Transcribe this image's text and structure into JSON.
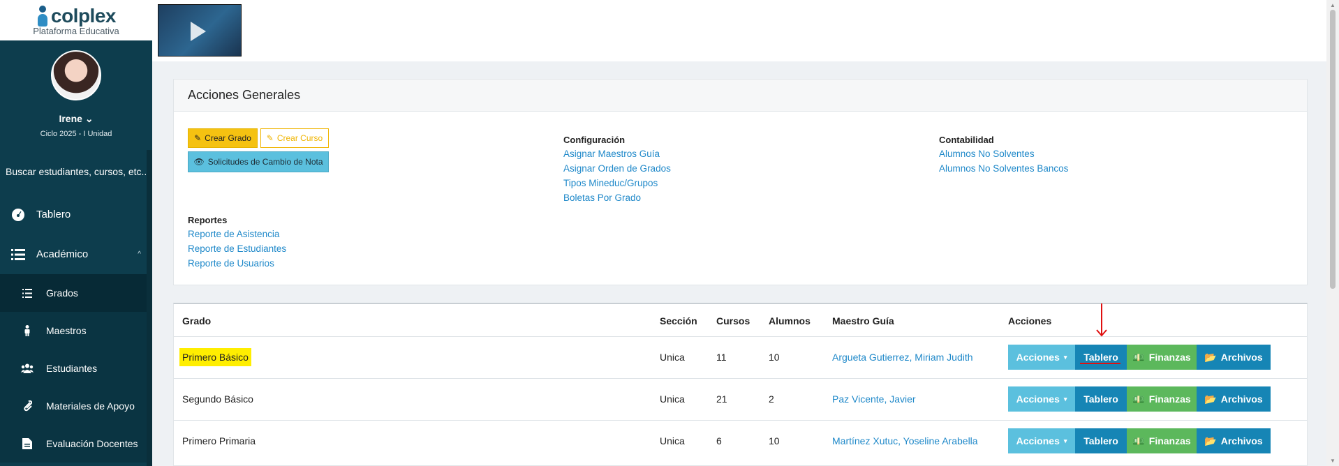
{
  "brand": {
    "name": "colplex",
    "subtitle": "Plataforma Educativa"
  },
  "user": {
    "name": "Irene",
    "cycle": "Ciclo 2025 - I Unidad"
  },
  "sidebar": {
    "search_label": "Buscar estudiantes, cursos, etc...",
    "items": [
      {
        "label": "Tablero",
        "icon": "dashboard-icon"
      },
      {
        "label": "Académico",
        "icon": "list-icon"
      }
    ],
    "sub_items": [
      {
        "label": "Grados",
        "icon": "list-icon",
        "active": true
      },
      {
        "label": "Maestros",
        "icon": "person-icon"
      },
      {
        "label": "Estudiantes",
        "icon": "users-icon"
      },
      {
        "label": "Materiales de Apoyo",
        "icon": "paperclip-icon"
      },
      {
        "label": "Evaluación Docentes",
        "icon": "document-icon"
      }
    ]
  },
  "panel": {
    "title": "Acciones Generales",
    "buttons": {
      "crear_grado": "Crear Grado",
      "crear_curso": "Crear Curso",
      "solicitudes": "Solicitudes de Cambio de Nota"
    },
    "configuracion": {
      "title": "Configuración",
      "links": [
        "Asignar Maestros Guía",
        "Asignar Orden de Grados",
        "Tipos Mineduc/Grupos",
        "Boletas Por Grado"
      ]
    },
    "contabilidad": {
      "title": "Contabilidad",
      "links": [
        "Alumnos No Solventes",
        "Alumnos No Solventes Bancos"
      ]
    },
    "reportes": {
      "title": "Reportes",
      "links": [
        "Reporte de Asistencia",
        "Reporte de Estudiantes",
        "Reporte de Usuarios"
      ]
    }
  },
  "table": {
    "headers": [
      "Grado",
      "Sección",
      "Cursos",
      "Alumnos",
      "Maestro Guía",
      "Acciones"
    ],
    "action_labels": {
      "acciones": "Acciones",
      "tablero": "Tablero",
      "finanzas": "Finanzas",
      "archivos": "Archivos"
    },
    "rows": [
      {
        "grado": "Primero Básico",
        "seccion": "Unica",
        "cursos": "11",
        "alumnos": "10",
        "maestro": "Argueta Gutierrez, Miriam Judith",
        "highlighted": true
      },
      {
        "grado": "Segundo Básico",
        "seccion": "Unica",
        "cursos": "21",
        "alumnos": "2",
        "maestro": "Paz Vicente, Javier"
      },
      {
        "grado": "Primero Primaria",
        "seccion": "Unica",
        "cursos": "6",
        "alumnos": "10",
        "maestro": "Martínez Xutuc, Yoseline Arabella"
      }
    ]
  },
  "colors": {
    "sidebar": "#0d3d4d",
    "link": "#1e88c9",
    "warning": "#f5c211",
    "info": "#5bc0de",
    "primary": "#1685b5",
    "success": "#5cb85c",
    "highlight": "#ffee00",
    "annotation": "#e01010"
  }
}
